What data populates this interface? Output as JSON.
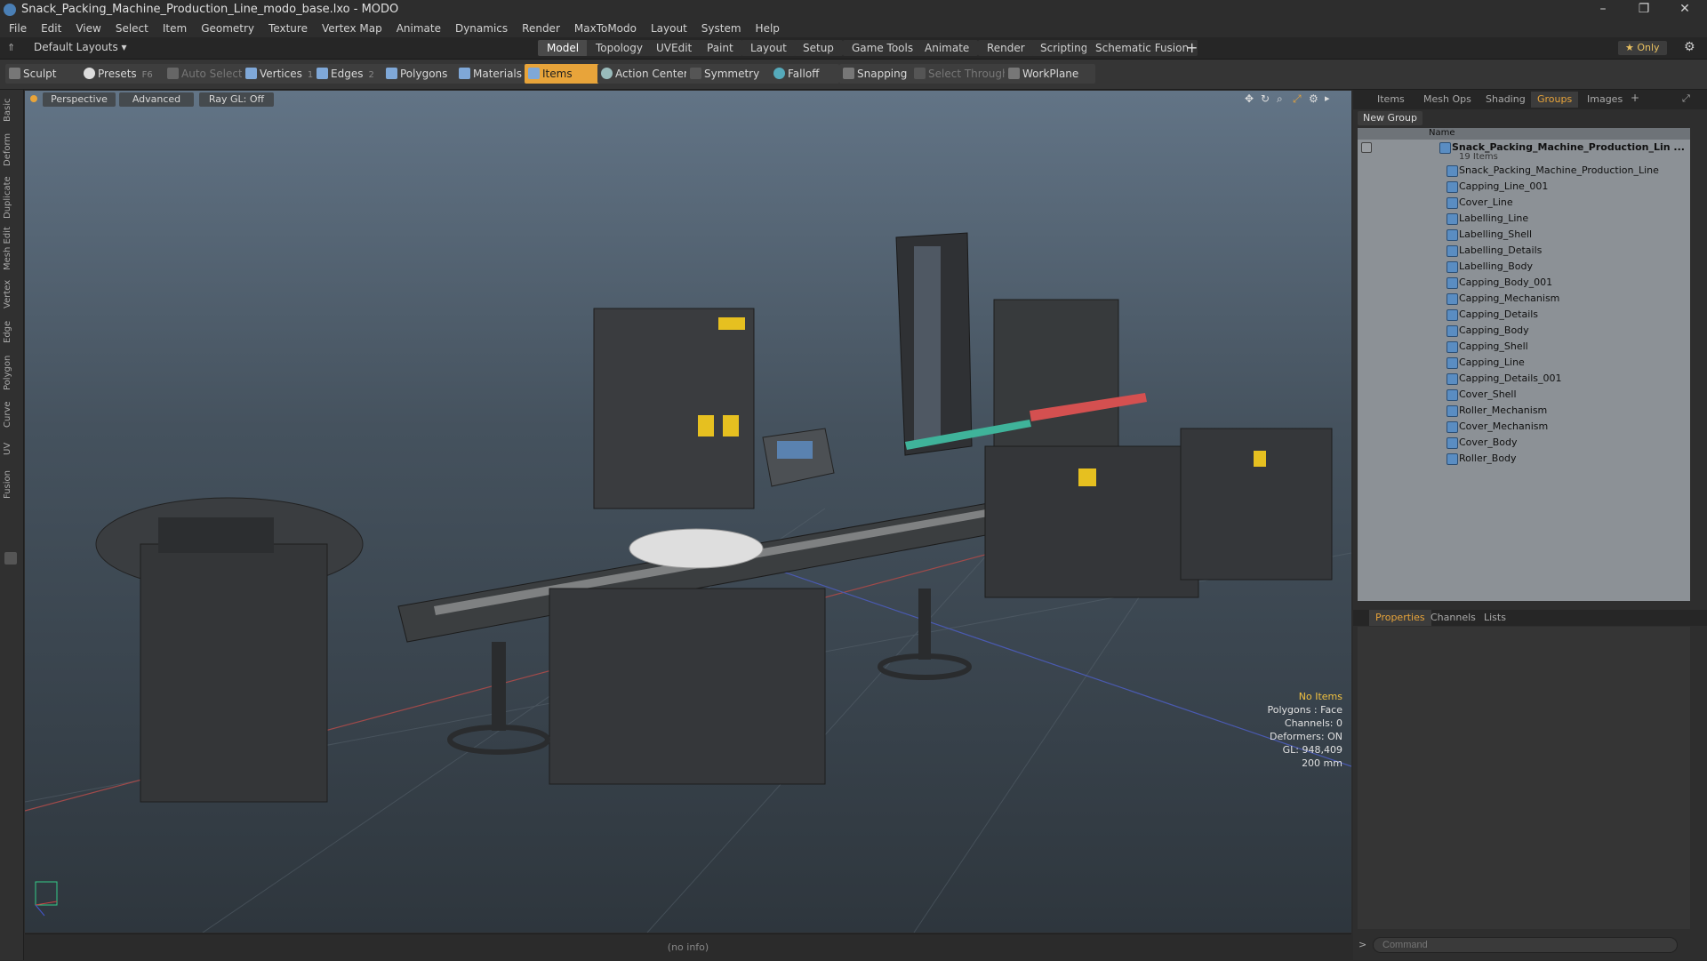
{
  "window": {
    "title": "Snack_Packing_Machine_Production_Line_modo_base.lxo - MODO",
    "minimize": "–",
    "restore": "❐",
    "close": "✕"
  },
  "menu": [
    "File",
    "Edit",
    "View",
    "Select",
    "Item",
    "Geometry",
    "Texture",
    "Vertex Map",
    "Animate",
    "Dynamics",
    "Render",
    "MaxToModo",
    "Layout",
    "System",
    "Help"
  ],
  "layout": {
    "preset": "Default Layouts ▾",
    "tabs": [
      "Model",
      "Topology",
      "UVEdit",
      "Paint",
      "Layout",
      "Setup",
      "Game Tools",
      "Animate",
      "Render",
      "Scripting",
      "Schematic Fusion"
    ],
    "active_tab": "Model",
    "add": "+",
    "only_label": "★ Only"
  },
  "toolbar": {
    "sculpt": "Sculpt",
    "presets": "Presets",
    "presets_key": "F6",
    "auto_select": "Auto Select",
    "vertices": "Vertices",
    "vertices_count": "1",
    "edges": "Edges",
    "edges_count": "2",
    "polygons": "Polygons",
    "materials": "Materials",
    "items": "Items",
    "action_center": "Action Center",
    "symmetry": "Symmetry",
    "falloff": "Falloff",
    "snapping": "Snapping",
    "select_through": "Select Through",
    "workplane": "WorkPlane"
  },
  "left_tabs": [
    "Basic",
    "Deform",
    "Duplicate",
    "Mesh Edit",
    "Vertex",
    "Edge",
    "Polygon",
    "Curve",
    "UV",
    "Fusion"
  ],
  "viewport": {
    "view": "Perspective",
    "shading": "Advanced",
    "raygl": "Ray GL: Off",
    "info": {
      "selection": "No Items",
      "polygons": "Polygons : Face",
      "channels": "Channels: 0",
      "deformers": "Deformers: ON",
      "gl": "GL: 948,409",
      "scale": "200 mm"
    },
    "status": "(no info)"
  },
  "panel": {
    "tabs": [
      "Items",
      "Mesh Ops",
      "Shading",
      "Groups",
      "Images"
    ],
    "active_tab": "Groups",
    "new_group": "New Group",
    "col_name": "Name",
    "group_name": "Snack_Packing_Machine_Production_Lin ...",
    "group_count": "19 Items",
    "items": [
      "Snack_Packing_Machine_Production_Line",
      "Capping_Line_001",
      "Cover_Line",
      "Labelling_Line",
      "Labelling_Shell",
      "Labelling_Details",
      "Labelling_Body",
      "Capping_Body_001",
      "Capping_Mechanism",
      "Capping_Details",
      "Capping_Body",
      "Capping_Shell",
      "Capping_Line",
      "Capping_Details_001",
      "Cover_Shell",
      "Roller_Mechanism",
      "Cover_Mechanism",
      "Cover_Body",
      "Roller_Body"
    ],
    "bottom_tabs": [
      "Properties",
      "Channels",
      "Lists"
    ],
    "bottom_active": "Properties",
    "command_placeholder": "Command"
  },
  "colors": {
    "accent": "#e8a43a",
    "selection_info": "#f0c040"
  }
}
